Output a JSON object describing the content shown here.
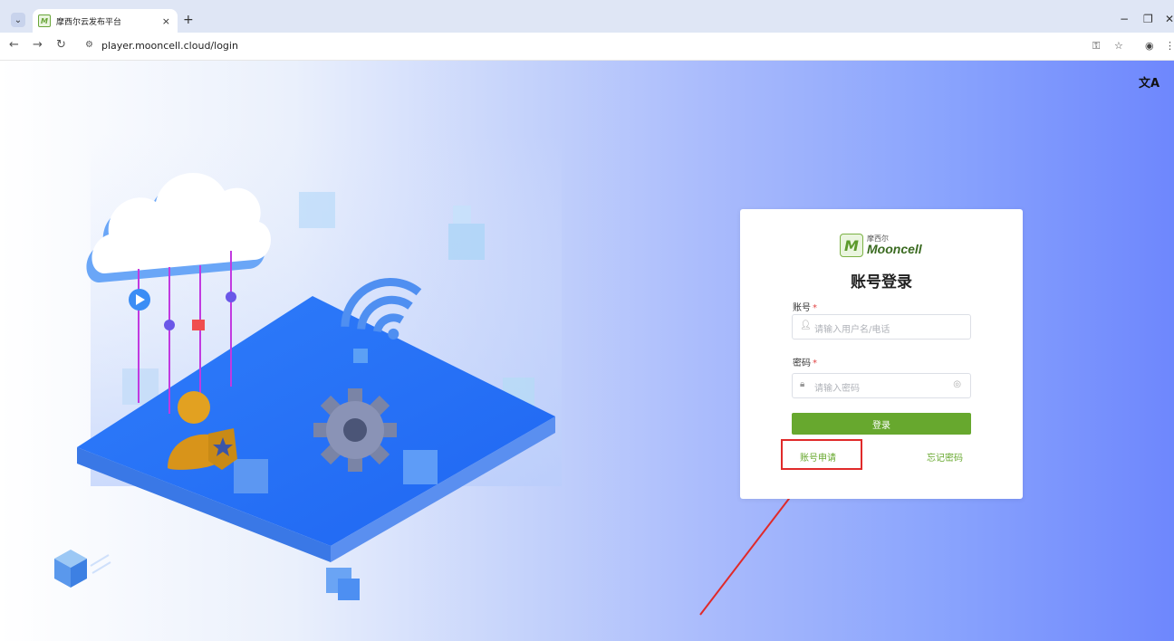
{
  "browser": {
    "tab_title": "摩西尔云发布平台",
    "tab_close": "×",
    "new_tab": "+",
    "url": "player.mooncell.cloud/login",
    "controls": {
      "minimize": "−",
      "restore": "❐",
      "close": "✕"
    }
  },
  "page": {
    "translate_icon": "文A"
  },
  "login": {
    "logo_cn": "摩西尔",
    "logo_en": "Mooncell",
    "title": "账号登录",
    "account_label": "账号",
    "account_placeholder": "请输入用户名/电话",
    "password_label": "密码",
    "password_placeholder": "请输入密码",
    "required_mark": "*",
    "submit": "登录",
    "apply_link": "账号申请",
    "forgot_link": "忘记密码"
  },
  "colors": {
    "brand_green": "#67a82e",
    "annotation_red": "#e02a2a"
  }
}
